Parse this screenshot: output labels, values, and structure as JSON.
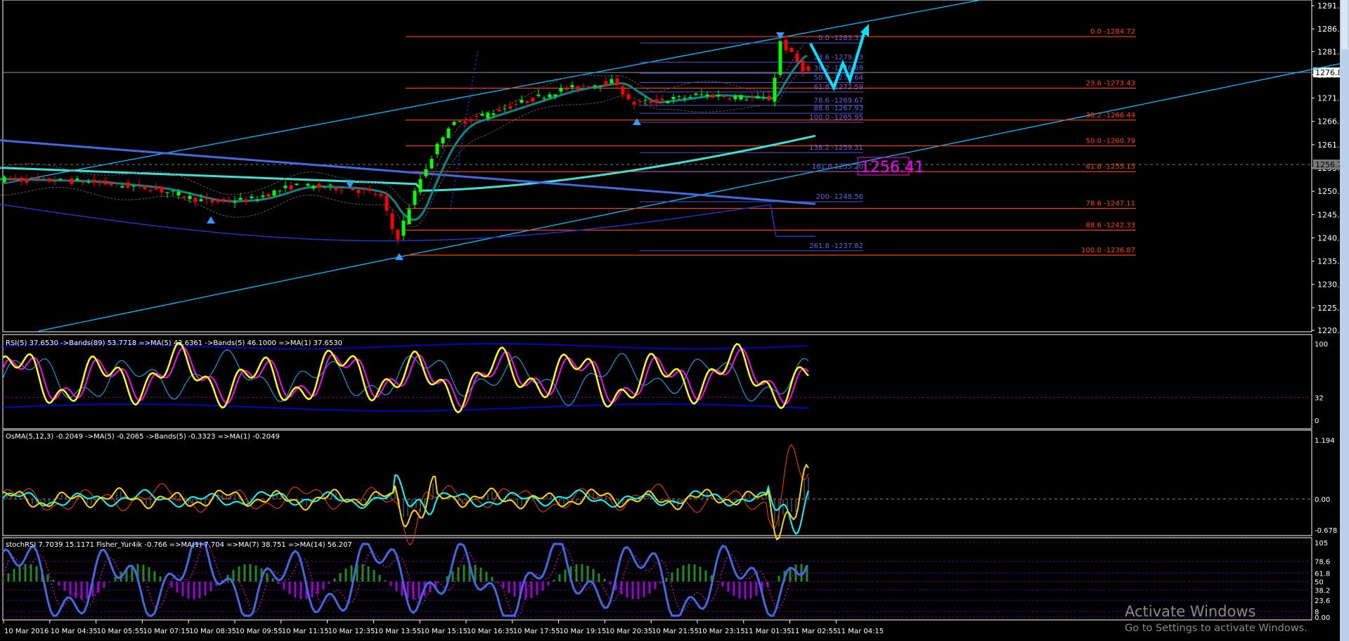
{
  "price_axis": {
    "ticks": [
      "1291.50",
      "1286.40",
      "1281.45",
      "1276.35",
      "1271.25",
      "1266.15",
      "1261.05",
      "1255.95",
      "1250.85",
      "1245.75",
      "1240.65",
      "1235.55",
      "1230.45",
      "1225.35",
      "1220.40"
    ],
    "tick_values": [
      1291.5,
      1286.4,
      1281.45,
      1276.35,
      1271.25,
      1266.15,
      1261.05,
      1255.95,
      1250.85,
      1245.75,
      1240.65,
      1235.55,
      1230.45,
      1225.35,
      1220.4
    ],
    "current_price": "1276.87",
    "current_price_value": 1276.87,
    "marker_price": "1256.72",
    "marker_price_value": 1256.72
  },
  "fib_orange": {
    "color": "#ff4000",
    "levels": [
      {
        "label": "0.0 -1284.72",
        "price": 1284.72
      },
      {
        "label": "23.6 -1273.43",
        "price": 1273.43
      },
      {
        "label": "38.2 -1266.44",
        "price": 1266.44
      },
      {
        "label": "50.0 -1260.79",
        "price": 1260.79
      },
      {
        "label": "61.8 -1255.15",
        "price": 1255.15
      },
      {
        "label": "78.6 -1247.11",
        "price": 1247.11
      },
      {
        "label": "88.6 -1242.33",
        "price": 1242.33
      },
      {
        "label": "100.0 -1236.87",
        "price": 1236.87
      }
    ]
  },
  "fib_purple": {
    "color": "#5a4fd0",
    "levels": [
      {
        "label": "0.0 -1283.33",
        "price": 1283.33
      },
      {
        "label": "23.6 -1279.13",
        "price": 1279.13
      },
      {
        "label": "38.2 -1276.69",
        "price": 1276.69
      },
      {
        "label": "50.0 -1274.64",
        "price": 1274.64
      },
      {
        "label": "61.8 -1272.59",
        "price": 1272.59
      },
      {
        "label": "78.6 -1269.67",
        "price": 1269.67
      },
      {
        "label": "88.6 -1267.93",
        "price": 1267.93
      },
      {
        "label": "100.0 -1265.95",
        "price": 1265.95
      },
      {
        "label": "138.2  -1259.31",
        "price": 1259.31
      },
      {
        "label": "161.8 1255.20",
        "price": 1255.2
      },
      {
        "label": "200- 1248.56",
        "price": 1248.56
      },
      {
        "label": "261.8 -1237.82",
        "price": 1237.82
      }
    ]
  },
  "price_label_big": {
    "text": "1256.41",
    "color": "#ff00ff"
  },
  "rsi_panel": {
    "header": "RSI(5) 37.6530  ->Bands(89) 53.7718  =>MA(5) 42.6361  ->Bands(5) 46.1000  =>MA(1) 37.6530",
    "scale": [
      "100",
      "32",
      "0"
    ]
  },
  "osma_panel": {
    "header": "OsMA(5,12,3) -0.2049  ->MA(5) -0.2065  ->Bands(5) -0.3323  =>MA(1) -0.2049",
    "scale": [
      "1.194",
      "0.00",
      "-0.678"
    ]
  },
  "stoch_panel": {
    "header": "stochRSI 7.7039 15.1171  Fisher_Yur4ik -0.766  =>MA(1) 7.704  =>MA(7) 38.751  =>MA(14) 56.207",
    "scale": [
      "105",
      "78.6",
      "61.8",
      "50",
      "38.2",
      "23.6",
      "8",
      "0.00"
    ]
  },
  "time_axis": [
    "10 Mar 2016",
    "10 Mar 04:35",
    "10 Mar 05:55",
    "10 Mar 07:15",
    "10 Mar 08:35",
    "10 Mar 09:55",
    "10 Mar 11:15",
    "10 Mar 12:35",
    "10 Mar 13:55",
    "10 Mar 15:15",
    "10 Mar 16:35",
    "10 Mar 17:55",
    "10 Mar 19:15",
    "10 Mar 20:35",
    "10 Mar 21:55",
    "10 Mar 23:15",
    "11 Mar 01:35",
    "11 Mar 02:55",
    "11 Mar 04:15"
  ],
  "watermark": {
    "title": "Activate Windows",
    "subtitle": "Go to Settings to activate Windows."
  },
  "colors": {
    "bull": "#00ff00",
    "bear": "#ff0000",
    "channel": "#00bfff",
    "rsi": "#ffff00",
    "ma": "#00ffff",
    "stoch": "#4169e1",
    "hist_pos": "#1e8c1e",
    "hist_neg": "#9b00d9"
  }
}
